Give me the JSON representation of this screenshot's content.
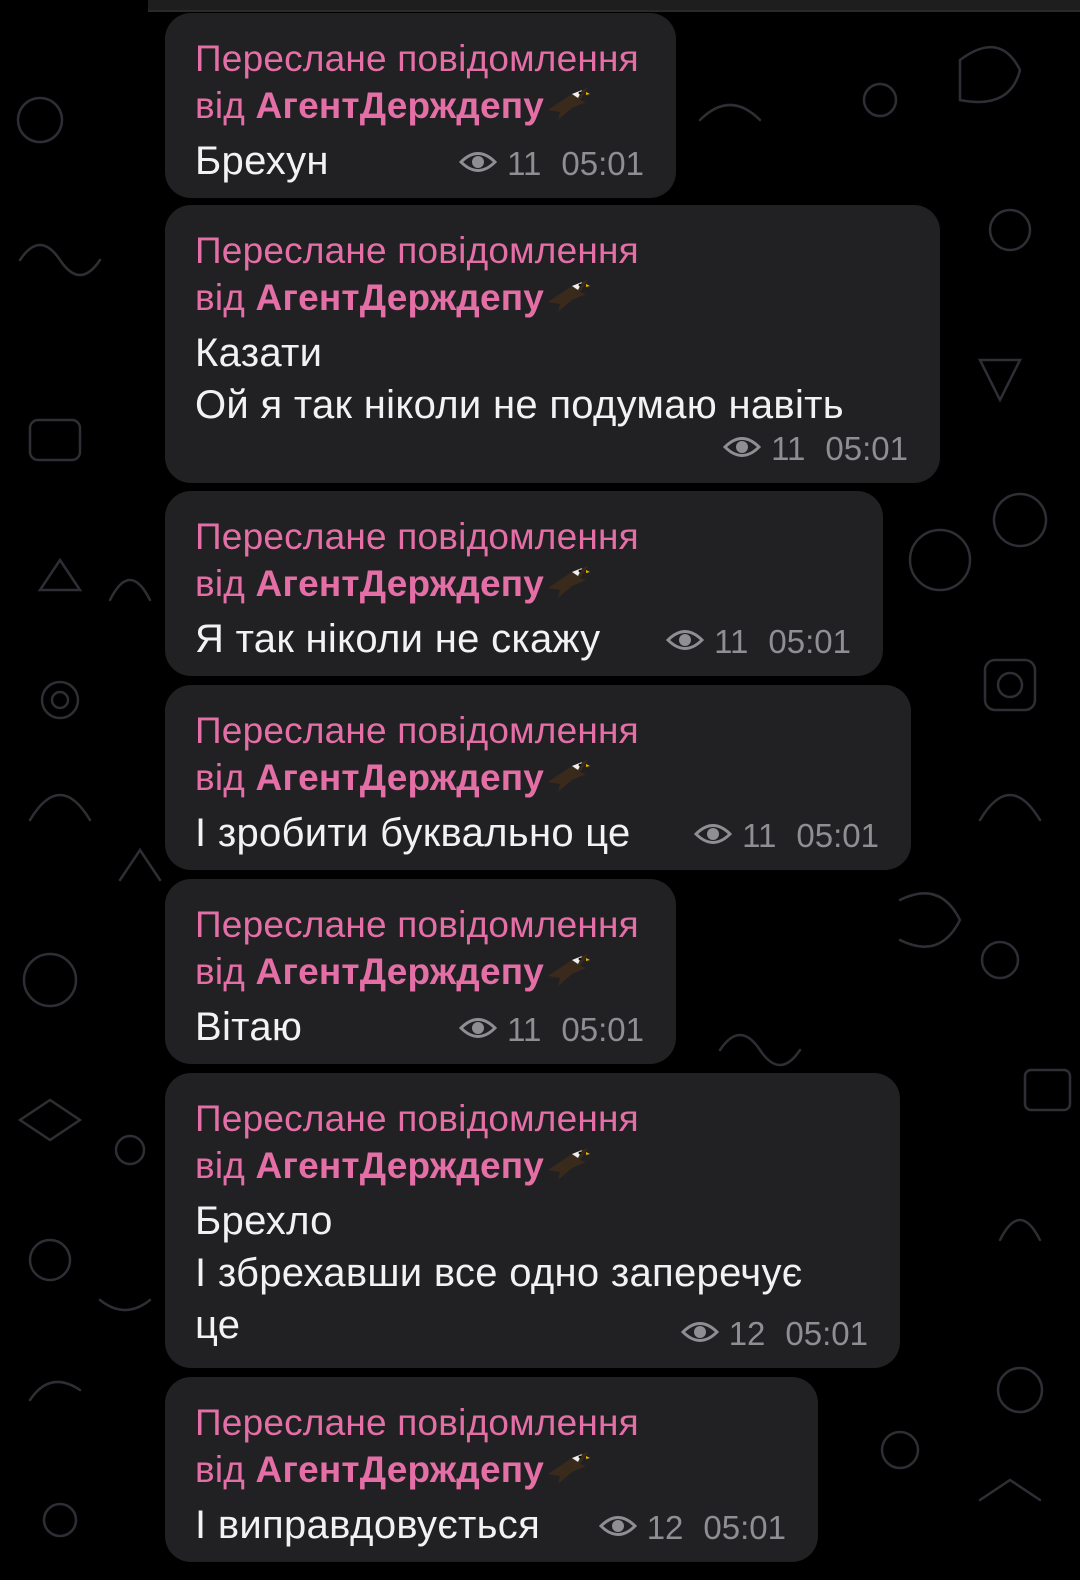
{
  "chat": {
    "messages": [
      {
        "forward_label": "Переслане повідомлення",
        "from_prefix": "від ",
        "from_name": "АгентДерждепу",
        "text_lines": [
          "Брехун"
        ],
        "views": "11",
        "time": "05:01"
      },
      {
        "forward_label": "Переслане повідомлення",
        "from_prefix": "від ",
        "from_name": "АгентДерждепу",
        "text_lines": [
          "Казати",
          "Ой я так ніколи не подумаю навіть"
        ],
        "views": "11",
        "time": "05:01"
      },
      {
        "forward_label": "Переслане повідомлення",
        "from_prefix": "від ",
        "from_name": "АгентДерждепу",
        "text_lines": [
          "Я так ніколи не скажу"
        ],
        "views": "11",
        "time": "05:01"
      },
      {
        "forward_label": "Переслане повідомлення",
        "from_prefix": "від ",
        "from_name": "АгентДерждепу",
        "text_lines": [
          "І зробити буквально це"
        ],
        "views": "11",
        "time": "05:01"
      },
      {
        "forward_label": "Переслане повідомлення",
        "from_prefix": "від ",
        "from_name": "АгентДерждепу",
        "text_lines": [
          "Вітаю"
        ],
        "views": "11",
        "time": "05:01"
      },
      {
        "forward_label": "Переслане повідомлення",
        "from_prefix": "від ",
        "from_name": "АгентДерждепу",
        "text_lines": [
          "Брехло",
          "І збрехавши все одно заперечує",
          "це"
        ],
        "views": "12",
        "time": "05:01"
      },
      {
        "forward_label": "Переслане повідомлення",
        "from_prefix": "від ",
        "from_name": "АгентДерждепу",
        "text_lines": [
          "І виправдовується"
        ],
        "views": "12",
        "time": "05:01"
      }
    ]
  },
  "icons": {
    "views": "eye-icon",
    "sender_emoji": "eagle-emoji-icon"
  },
  "colors": {
    "background": "#000000",
    "bubble": "#212123",
    "forward_text": "#e46ea6",
    "message_text": "#f2f2f2",
    "meta_text": "#8e8e93"
  }
}
